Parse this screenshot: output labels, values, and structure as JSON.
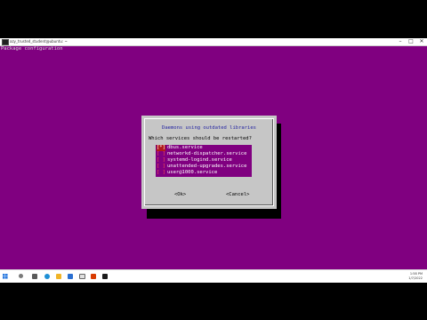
{
  "window": {
    "title": "azy_trusted_student@ubuntu: ~",
    "minimize_glyph": "–",
    "maximize_glyph": "□",
    "close_glyph": "✕"
  },
  "terminal": {
    "header": "Package configuration",
    "background_color": "#800080"
  },
  "dialog": {
    "title": "Daemons using outdated libraries",
    "question": "Which services should be restarted?",
    "services": [
      {
        "checkbox": "[*]",
        "label": "dbus.service"
      },
      {
        "checkbox": "[ ]",
        "label": "networkd-dispatcher.service"
      },
      {
        "checkbox": "[ ]",
        "label": "systemd-logind.service"
      },
      {
        "checkbox": "[ ]",
        "label": "unattended-upgrades.service"
      },
      {
        "checkbox": "[ ]",
        "label": "user@1000.service"
      }
    ],
    "ok_label": "<Ok>",
    "cancel_label": "<Cancel>"
  },
  "taskbar": {
    "icons": [
      "start-icon",
      "search-icon",
      "task-view-icon",
      "edge-icon",
      "explorer-icon",
      "store-icon",
      "mail-icon",
      "office-icon",
      "terminal-icon"
    ],
    "time": "1:58 PM",
    "date": "1/7/2022"
  }
}
